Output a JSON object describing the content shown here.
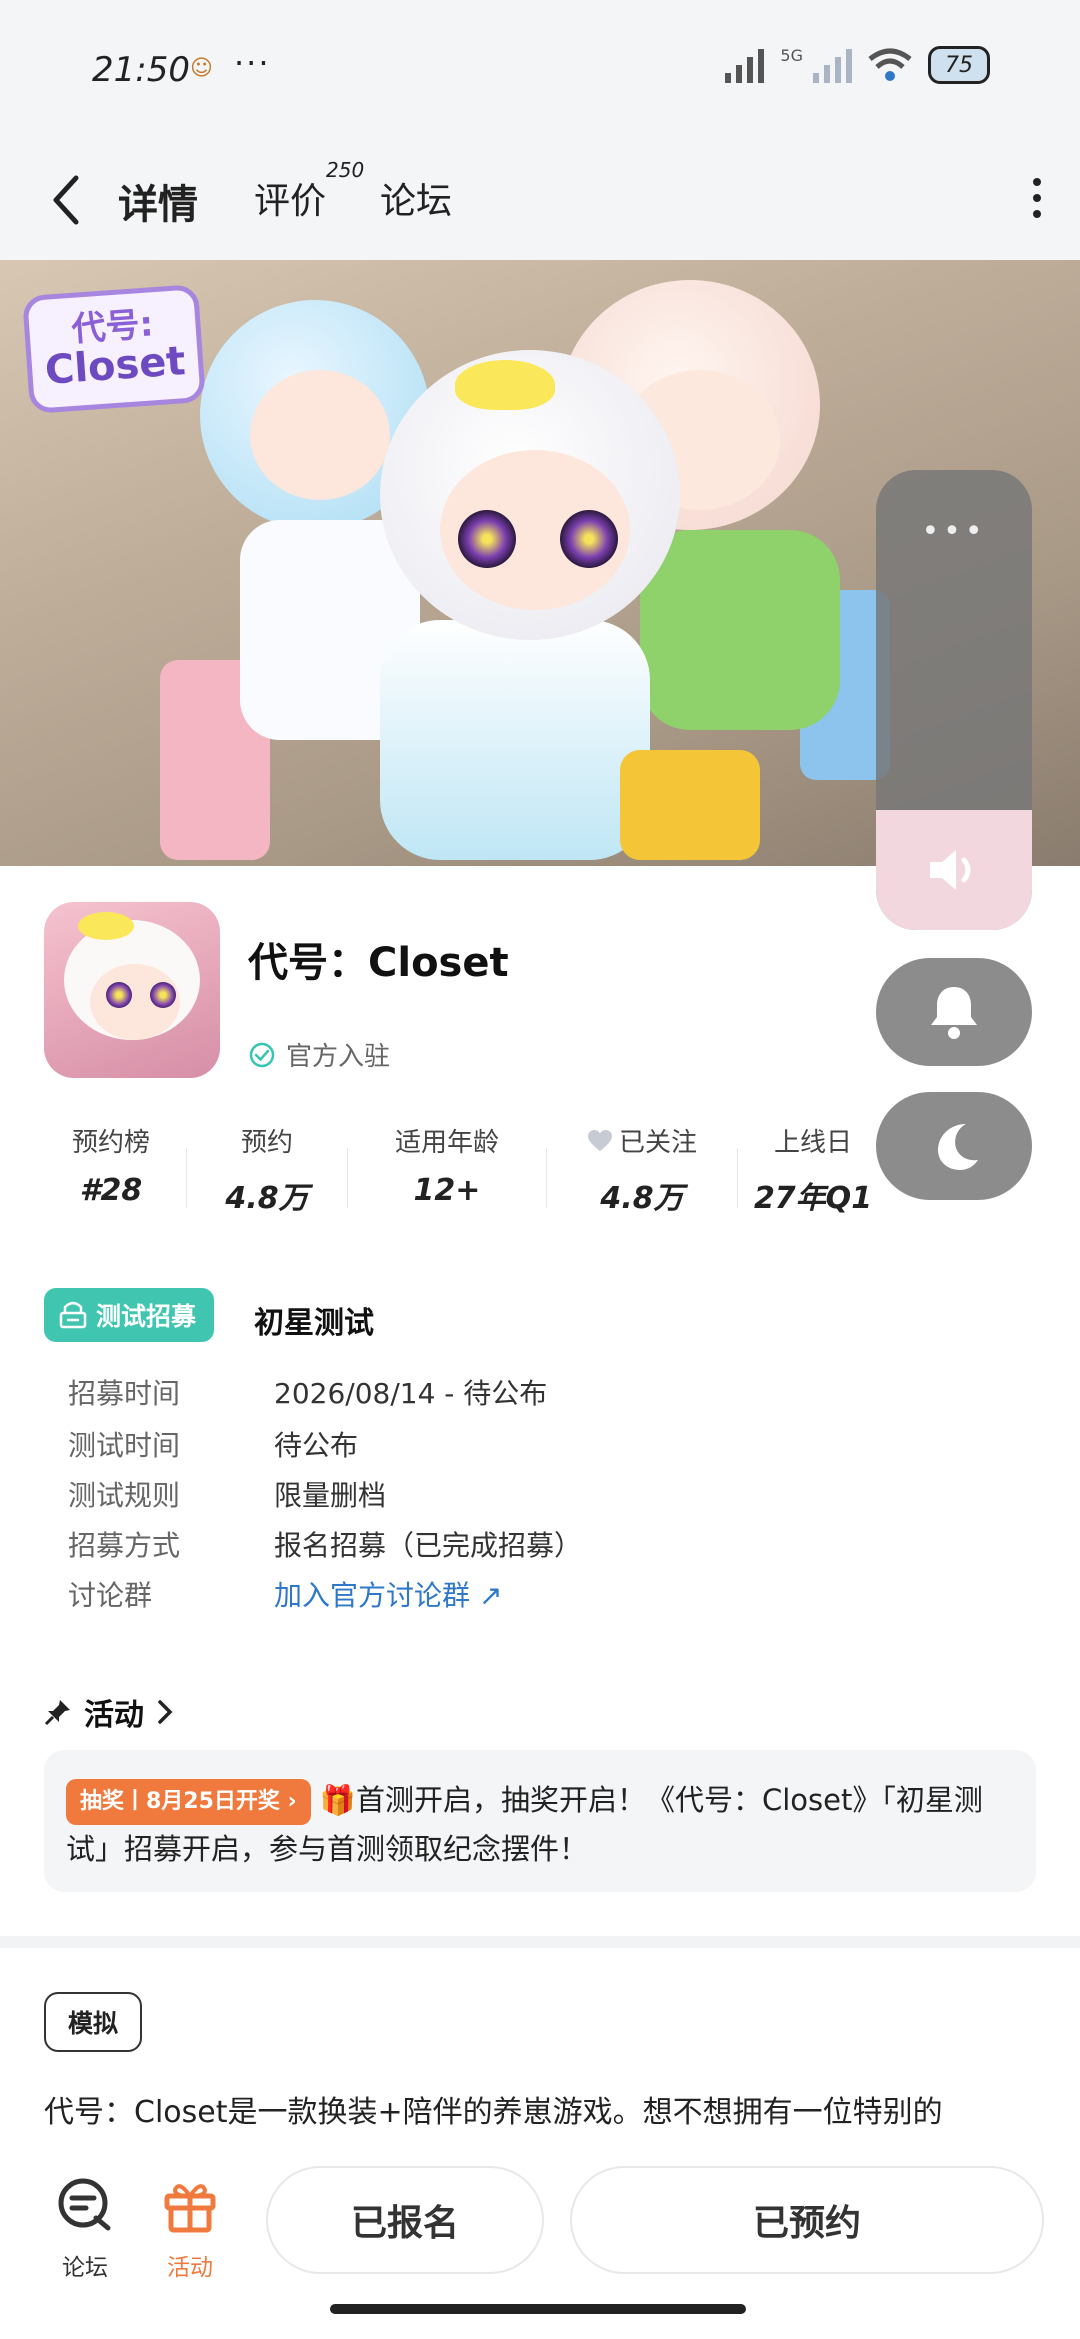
{
  "status_bar": {
    "time": "21:50",
    "notification_glyph": "☺",
    "more": "···",
    "network": "5G",
    "battery": "75"
  },
  "nav": {
    "tabs": [
      {
        "label": "详情",
        "active": true
      },
      {
        "label": "评价",
        "count": "250"
      },
      {
        "label": "论坛"
      }
    ]
  },
  "banner": {
    "logo_line1": "代号:",
    "logo_line2": "Closet"
  },
  "app": {
    "title": "代号：Closet",
    "official_label": "官方入驻"
  },
  "stats": [
    {
      "label": "预约榜",
      "value": "#28"
    },
    {
      "label": "预约",
      "value": "4.8万"
    },
    {
      "label": "适用年龄",
      "value": "12+"
    },
    {
      "label": "已关注",
      "value": "4.8万",
      "icon": "heart-icon"
    },
    {
      "label": "上线日",
      "value": "27年Q1"
    }
  ],
  "recruit": {
    "badge": "测试招募",
    "title": "初星测试",
    "rows": [
      {
        "key": "招募时间",
        "value": "2026/08/14 -  待公布"
      },
      {
        "key": "测试时间",
        "value": "待公布"
      },
      {
        "key": "测试规则",
        "value": "限量删档"
      },
      {
        "key": "招募方式",
        "value": "报名招募（已完成招募）"
      },
      {
        "key": "讨论群",
        "value": "加入官方讨论群 ↗"
      }
    ]
  },
  "activity": {
    "title": "活动",
    "tag": "抽奖丨8月25日开奖 ›",
    "text": "🎁首测开启，抽奖开启！《代号：Closet》「初星测试」招募开启，参与首测领取纪念摆件！"
  },
  "genre": "模拟",
  "description": "代号：Closet是一款换装+陪伴的养崽游戏。想不想拥有一位特别的",
  "bottom": {
    "forum_label": "论坛",
    "activity_label": "活动",
    "signed_up": "已报名",
    "reserved": "已预约"
  },
  "colors": {
    "accent": "#37c4b0",
    "orange": "#f07a3e",
    "link": "#2f78c9"
  }
}
